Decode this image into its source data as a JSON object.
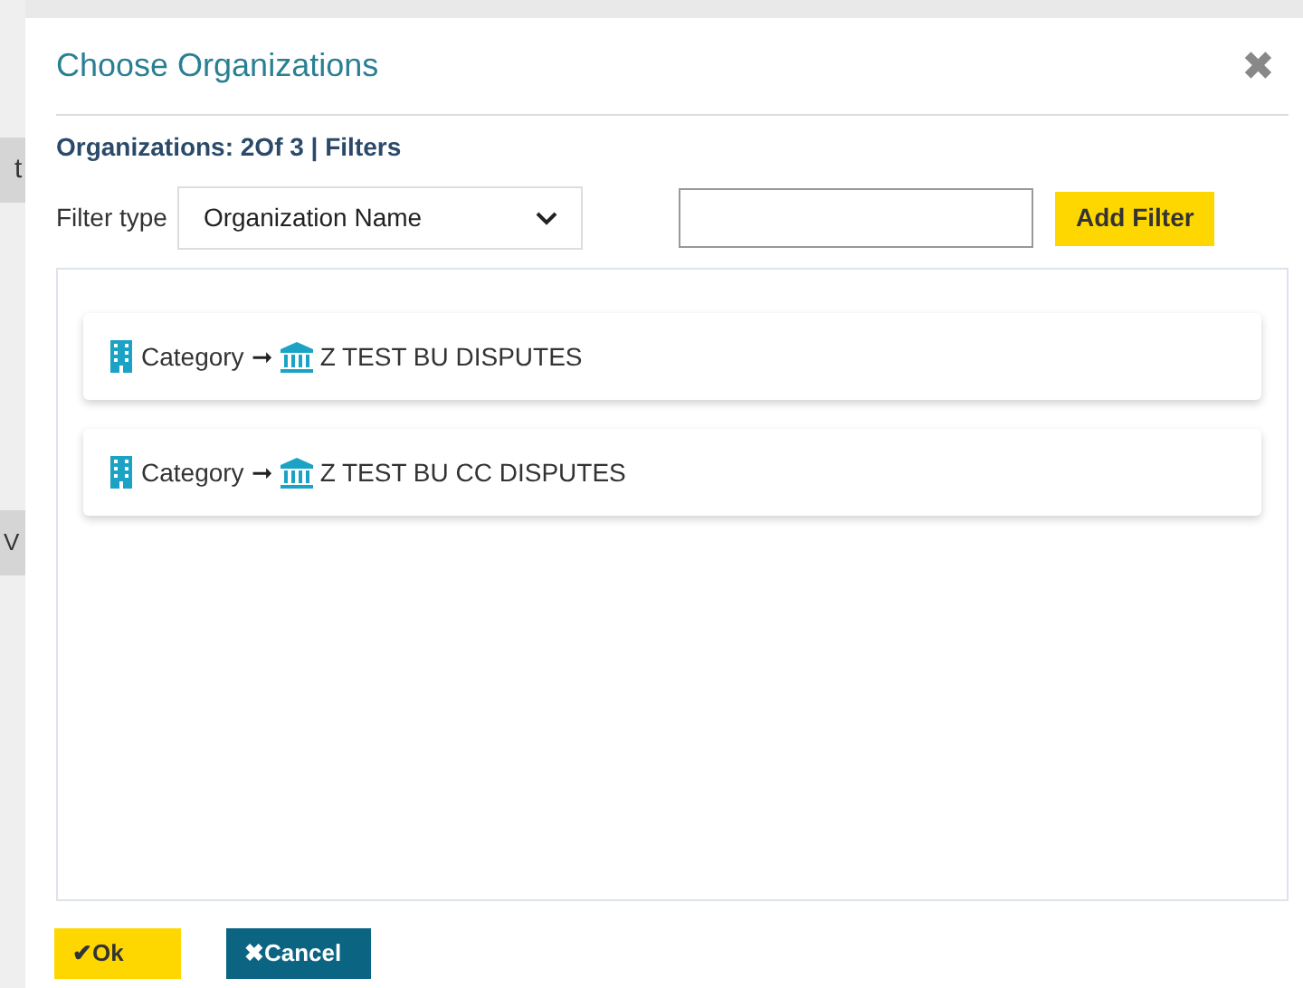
{
  "background": {
    "fragments": [
      "t",
      "V"
    ]
  },
  "dialog": {
    "title": "Choose Organizations",
    "close": "✖",
    "summary": "Organizations: 2Of 3 | Filters",
    "filter": {
      "label": "Filter type",
      "select_value": "Organization Name",
      "button": "Add Filter"
    },
    "results": [
      {
        "category": "Category",
        "arrow": "➞",
        "name": "Z TEST BU DISPUTES"
      },
      {
        "category": "Category",
        "arrow": "➞",
        "name": "Z TEST BU CC DISPUTES"
      }
    ],
    "buttons": [
      {
        "kind": "ok",
        "icon": "✔",
        "label": "Ok"
      },
      {
        "kind": "cancel",
        "icon": "✖",
        "label": "Cancel"
      }
    ]
  }
}
